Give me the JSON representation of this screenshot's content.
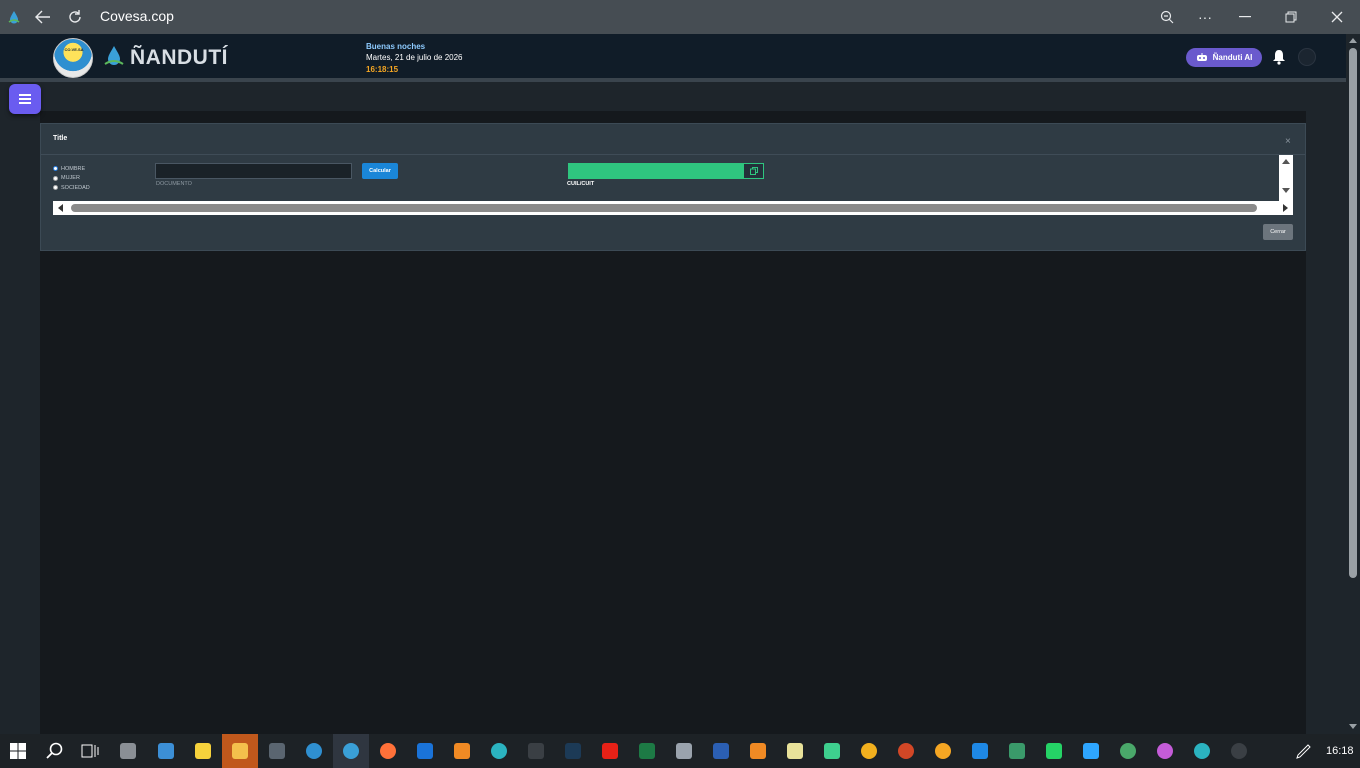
{
  "browser": {
    "title": "Covesa.cop",
    "icons": [
      "edge-favicon-icon",
      "back-arrow-icon",
      "refresh-icon",
      "zoom-icon",
      "more-icon",
      "minimize-icon",
      "restore-icon",
      "close-icon"
    ]
  },
  "header": {
    "logo_text": "CO.VE.SA",
    "brand": "ÑANDUTÍ",
    "greeting": "Buenas noches",
    "date": "Martes, 21 de julio de 2026",
    "time": "16:18:15",
    "ai_button": "Ñanduti AI",
    "colors": {
      "header_bg": "#101c28",
      "accent": "#6a5acd",
      "time": "#f5a623",
      "greeting": "#8ecbff"
    }
  },
  "modal": {
    "title": "Title",
    "close_glyph": "×",
    "radios": [
      {
        "label": "HOMBRE",
        "checked": true
      },
      {
        "label": "MUJER",
        "checked": false
      },
      {
        "label": "SOCIEDAD",
        "checked": false
      }
    ],
    "documento": {
      "value": "",
      "label": "DOCUMENTO"
    },
    "calcular_label": "Calcular",
    "cuil": {
      "value": "",
      "label": "CUIL/CUIT",
      "color": "#2fc57f"
    },
    "cerrar_label": "Cerrar"
  },
  "taskbar": {
    "time": "16:18",
    "apps": [
      "start",
      "search",
      "task-view",
      "app",
      "app",
      "app",
      "explorer",
      "calculator",
      "nanduti",
      "nanduti-active",
      "firefox",
      "outlook",
      "app",
      "edge",
      "app",
      "app",
      "youtube",
      "excel",
      "app",
      "word",
      "app",
      "app",
      "app",
      "app",
      "app",
      "vscode",
      "app",
      "whatsapp",
      "app",
      "chrome",
      "app",
      "edge",
      "app"
    ]
  }
}
